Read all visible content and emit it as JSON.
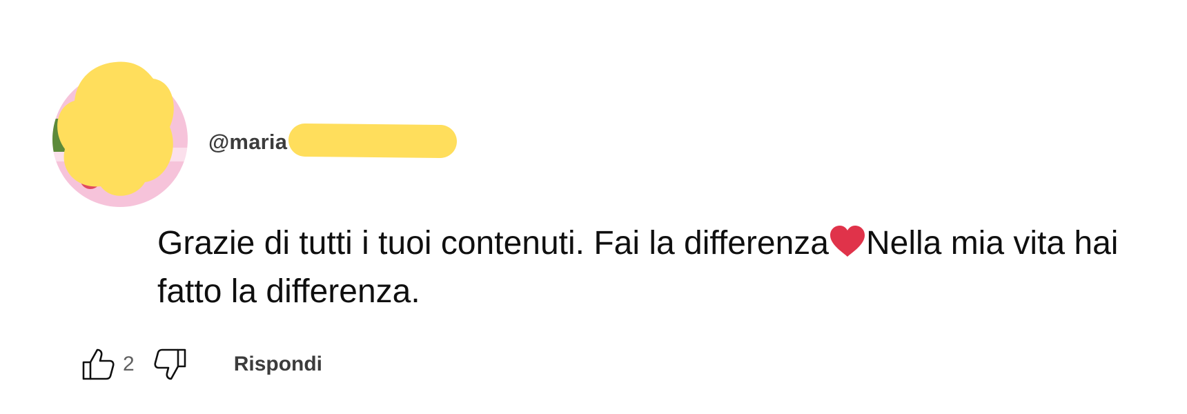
{
  "comment": {
    "author_handle": "@maria",
    "text_part1": "Grazie di tutti i tuoi contenuti. Fai la differenza",
    "emoji": "heart-emoji",
    "text_part2": "Nella mia vita hai fatto la differenza.",
    "like_count": "2",
    "reply_label": "Rispondi"
  },
  "colors": {
    "redaction": "#ffde5c",
    "heart": "#e0334a",
    "text": "#0f0f0f",
    "secondary_text": "#606060"
  },
  "icons": {
    "like": "thumbs-up-icon",
    "dislike": "thumbs-down-icon"
  }
}
